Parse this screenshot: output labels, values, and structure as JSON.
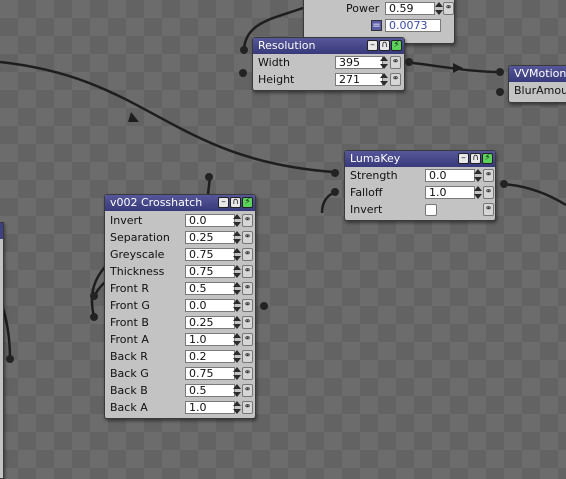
{
  "nodes": {
    "top_partial": {
      "rows": [
        {
          "label": "Power",
          "value": "0.59"
        }
      ],
      "extra_value": "0.0073"
    },
    "resolution": {
      "title": "Resolution",
      "rows": [
        {
          "label": "Width",
          "value": "395"
        },
        {
          "label": "Height",
          "value": "271"
        }
      ]
    },
    "vvmotion": {
      "title": "VVMotionB",
      "rows": [
        {
          "label": "BlurAmou"
        }
      ]
    },
    "lumakey": {
      "title": "LumaKey",
      "rows": [
        {
          "label": "Strength",
          "value": "0.0"
        },
        {
          "label": "Falloff",
          "value": "1.0"
        },
        {
          "label": "Invert"
        }
      ]
    },
    "crosshatch": {
      "title": "v002 Crosshatch",
      "rows": [
        {
          "label": "Invert",
          "value": "0.0"
        },
        {
          "label": "Separation",
          "value": "0.25"
        },
        {
          "label": "Greyscale",
          "value": "0.75"
        },
        {
          "label": "Thickness",
          "value": "0.75"
        },
        {
          "label": "Front R",
          "value": "0.5"
        },
        {
          "label": "Front G",
          "value": "0.0"
        },
        {
          "label": "Front B",
          "value": "0.25"
        },
        {
          "label": "Front A",
          "value": "1.0"
        },
        {
          "label": "Back R",
          "value": "0.2"
        },
        {
          "label": "Back G",
          "value": "0.75"
        },
        {
          "label": "Back B",
          "value": "0.5"
        },
        {
          "label": "Back A",
          "value": "1.0"
        }
      ]
    }
  },
  "header_icons": [
    "minimize-icon",
    "lock-icon",
    "enable-icon"
  ],
  "colors": {
    "canvas": "#6c6c6c",
    "node_body": "#c3c3c3",
    "node_header": "#3f4081",
    "enable_green": "#5bd35b",
    "wire": "#1e1e1e"
  }
}
